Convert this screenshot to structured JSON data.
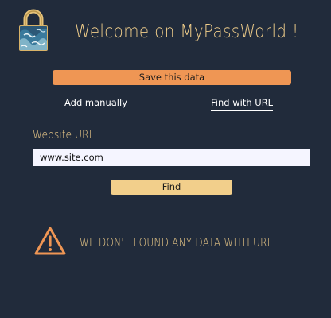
{
  "header": {
    "title": "Welcome on MyPassWorld !",
    "logo_icon": "padlock-icon"
  },
  "actions": {
    "save_label": "Save this data"
  },
  "tabs": [
    {
      "label": "Add manually",
      "active": false
    },
    {
      "label": "Find with URL",
      "active": true
    }
  ],
  "form": {
    "label": "Website URL :",
    "value": "www.site.com",
    "find_label": "Find"
  },
  "alert": {
    "icon": "warning-icon",
    "message": "WE DON'T FOUND ANY DATA WITH URL"
  },
  "colors": {
    "background": "#212b3b",
    "accent_orange": "#ef9654",
    "accent_yellow": "#f2cf8b",
    "input_bg": "#f5f5ff"
  }
}
